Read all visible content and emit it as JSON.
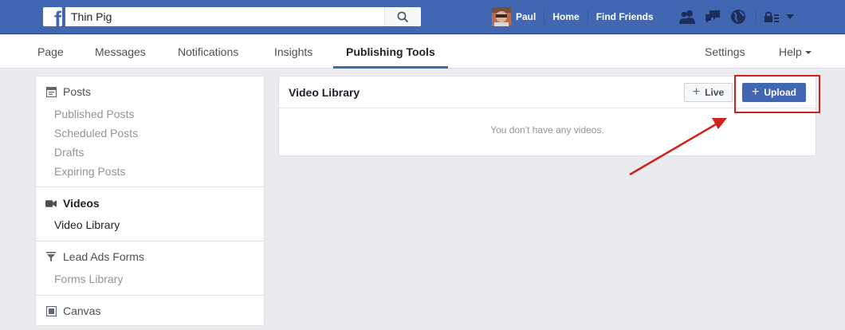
{
  "topbar": {
    "search_value": "Thin Pig",
    "search_placeholder": "Search",
    "user_name": "Paul",
    "home_label": "Home",
    "find_friends_label": "Find Friends",
    "icons": [
      "friend-requests-icon",
      "messages-icon",
      "notifications-globe-icon",
      "quick-help-lock-icon",
      "account-menu-icon"
    ]
  },
  "pagenav": {
    "tabs": [
      {
        "label": "Page"
      },
      {
        "label": "Messages"
      },
      {
        "label": "Notifications"
      },
      {
        "label": "Insights"
      },
      {
        "label": "Publishing Tools"
      }
    ],
    "settings_label": "Settings",
    "help_label": "Help"
  },
  "sidebar": {
    "posts": {
      "label": "Posts",
      "items": [
        "Published Posts",
        "Scheduled Posts",
        "Drafts",
        "Expiring Posts"
      ]
    },
    "videos": {
      "label": "Videos",
      "items": [
        "Video Library"
      ]
    },
    "lead_ads": {
      "label": "Lead Ads Forms",
      "items": [
        "Forms Library"
      ]
    },
    "canvas": {
      "label": "Canvas"
    }
  },
  "panel": {
    "title": "Video Library",
    "live_label": "Live",
    "upload_label": "Upload",
    "empty_message": "You don't have any videos."
  },
  "colors": {
    "brand_blue": "#4267b2",
    "annotation_red": "#d0211a"
  }
}
